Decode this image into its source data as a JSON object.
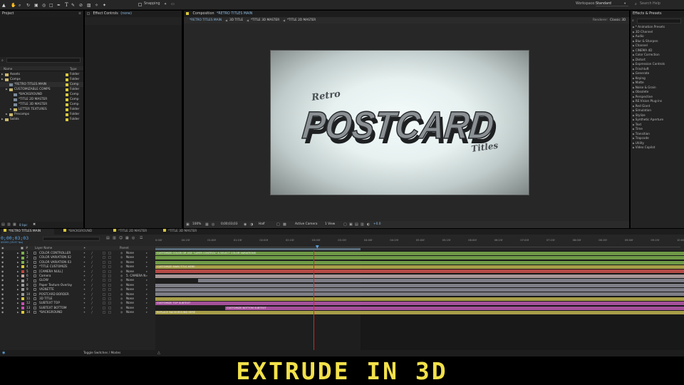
{
  "app": {
    "title": "After Effects"
  },
  "toolbar": {
    "snapping_label": "Snapping",
    "workspace_label": "Workspace:",
    "workspace_value": "Standard",
    "search_placeholder": "Search Help"
  },
  "project_panel": {
    "tab_label": "Project",
    "search_placeholder": "",
    "columns": {
      "name": "Name",
      "type": "Type"
    },
    "items": [
      {
        "name": "Assets",
        "type": "Folder",
        "color": "#d8c93a",
        "indent": 0,
        "kind": "folder"
      },
      {
        "name": "Comps",
        "type": "Folder",
        "color": "#d8c93a",
        "indent": 0,
        "kind": "folder"
      },
      {
        "name": "*RETRO TITLES MAIN",
        "type": "Comp",
        "color": "#d8c93a",
        "indent": 1,
        "kind": "comp"
      },
      {
        "name": "CUSTOMIZABLE COMPS",
        "type": "Folder",
        "color": "#d8c93a",
        "indent": 1,
        "kind": "folder"
      },
      {
        "name": "*BACKGROUND",
        "type": "Comp",
        "color": "#d8c93a",
        "indent": 2,
        "kind": "comp"
      },
      {
        "name": "*TITLE 2D MASTER",
        "type": "Comp",
        "color": "#d8c93a",
        "indent": 2,
        "kind": "comp"
      },
      {
        "name": "*TITLE 3D MASTER",
        "type": "Comp",
        "color": "#d8c93a",
        "indent": 2,
        "kind": "comp"
      },
      {
        "name": "LETTER TEXTURES",
        "type": "Folder",
        "color": "#d8c93a",
        "indent": 2,
        "kind": "folder"
      },
      {
        "name": "Precomps",
        "type": "Folder",
        "color": "#d8c93a",
        "indent": 1,
        "kind": "folder"
      },
      {
        "name": "Solids",
        "type": "Folder",
        "color": "#d8c93a",
        "indent": 0,
        "kind": "folder"
      }
    ],
    "footer_bpc": "8 bpc"
  },
  "effect_controls": {
    "tab_label": "Effect Controls",
    "tab_suffix": "(none)"
  },
  "composition": {
    "tab_label": "Composition",
    "tab_name": "*RETRO TITLES MAIN",
    "flow": [
      "*RETRO TITLES MAIN",
      "3D TITLE",
      "*TITLE 3D MASTER",
      "*TITLE 2D MASTER"
    ],
    "renderer_label": "Renderer:",
    "renderer_value": "Classic 3D",
    "artwork": {
      "script_top": "Retro",
      "main": "POSTCARD",
      "script_bottom": "Titles"
    },
    "footer": {
      "zoom": "100%",
      "timecode": "0;00;03;03",
      "resolution": "Half",
      "camera": "Active Camera",
      "views": "1 View",
      "exposure": "+0.0"
    }
  },
  "effects_presets": {
    "tab_label": "Effects & Presets",
    "search_placeholder": "",
    "categories": [
      "* Animation Presets",
      "3D Channel",
      "Audio",
      "Blur & Sharpen",
      "Channel",
      "CINEMA 4D",
      "Color Correction",
      "Distort",
      "Expression Controls",
      "Frischluft",
      "Generate",
      "Keying",
      "Matte",
      "Noise & Grain",
      "Obsolete",
      "Perspective",
      "RE:Vision Plug-ins",
      "Red Giant",
      "Simulation",
      "Stylize",
      "Synthetic Aperture",
      "Text",
      "Time",
      "Transition",
      "Trapcode",
      "Utility",
      "Video Copilot"
    ]
  },
  "timeline": {
    "tabs": [
      {
        "label": "*RETRO TITLES MAIN",
        "color": "#d8c93a",
        "active": true
      },
      {
        "label": "*BACKGROUND",
        "color": "#d8c93a",
        "active": false
      },
      {
        "label": "*TITLE 2D MASTER",
        "color": "#d8c93a",
        "active": false
      },
      {
        "label": "*TITLE 3D MASTER",
        "color": "#d8c93a",
        "active": false
      }
    ],
    "timecode": "0;00;03;03",
    "timecode_sub": "00093 (29.97 fps)",
    "columns": {
      "num": "#",
      "layer_name": "Layer Name",
      "parent": "Parent"
    },
    "layers": [
      {
        "num": "1",
        "name": "COLOR CONTROLLER",
        "color": "#7bb24a",
        "parent": "None",
        "bar_color": "#6f9a47",
        "bar_label": "CUSTOMIZE COLOR OR USE \"LAYER CONTROL\" & SELECT COLOR VARIATIONS"
      },
      {
        "num": "2",
        "name": "COLOR VARIATION 02",
        "color": "#7bb24a",
        "parent": "None",
        "bar_color": "#6f9a47",
        "bar_label": ""
      },
      {
        "num": "3",
        "name": "COLOR VARIATION 03",
        "color": "#7bb24a",
        "parent": "None",
        "bar_color": "#6f9a47",
        "bar_label": ""
      },
      {
        "num": "4",
        "name": "*TITLE CUSTOMIZE",
        "color": "#d8c93a",
        "parent": "None",
        "bar_color": "#a79e48",
        "bar_label": "CUSTOMIZE MAIN TITLE HERE"
      },
      {
        "num": "5",
        "name": "[CAMERA NULL]",
        "color": "#c0463d",
        "parent": "None",
        "bar_color": "#b44a46",
        "bar_label": ""
      },
      {
        "num": "6",
        "name": "Camera",
        "color": "#c7a9a3",
        "parent": "5. CAMERA N",
        "bar_color": "#a79797",
        "bar_label": ""
      },
      {
        "num": "7",
        "name": "GLOW",
        "color": "#9a9a9a",
        "parent": "None",
        "bar_color": "#7d7d86",
        "bar_label": ""
      },
      {
        "num": "8",
        "name": "Paper Texture Overlay",
        "color": "#9a9a9a",
        "parent": "None",
        "bar_color": "#7d7d86",
        "bar_label": ""
      },
      {
        "num": "9",
        "name": "VIGNETTE",
        "color": "#9a9a9a",
        "parent": "None",
        "bar_color": "#7d7d86",
        "bar_label": ""
      },
      {
        "num": "10",
        "name": "POSTCARD BORDER",
        "color": "#9a9a9a",
        "parent": "None",
        "bar_color": "#7d7d86",
        "bar_label": ""
      },
      {
        "num": "11",
        "name": "3D TITLE",
        "color": "#d8c93a",
        "parent": "None",
        "bar_color": "#a79e48",
        "bar_label": ""
      },
      {
        "num": "12",
        "name": "SUBTEXT TOP",
        "color": "#c84fb2",
        "parent": "None",
        "bar_color": "#a4519a",
        "bar_label": "CUSTOMIZE TOP SUBTEXT"
      },
      {
        "num": "13",
        "name": "SUBTEXT BOTTOM",
        "color": "#c84fb2",
        "parent": "None",
        "bar_color": "#a4519a",
        "bar_label": "CUSTOMIZE BOTTOM SUBTEXT"
      },
      {
        "num": "14",
        "name": "*BACKGROUND",
        "color": "#d8c93a",
        "parent": "None",
        "bar_color": "#a79e48",
        "bar_label": "REPLACE BACKGROUND HERE"
      }
    ],
    "ruler_labels": [
      "0:00f",
      "00:15f",
      "01:00f",
      "01:15f",
      "02:00f",
      "02:15f",
      "03:00f",
      "03:15f",
      "04:00f",
      "04:15f",
      "05:00f",
      "05:15f",
      "06:00f",
      "06:15f",
      "07:00f",
      "07:15f",
      "08:00f",
      "08:15f",
      "09:00f",
      "09:15f",
      "10:00"
    ],
    "footer_label": "Toggle Switches / Modes"
  },
  "caption": "EXTRUDE IN 3D"
}
